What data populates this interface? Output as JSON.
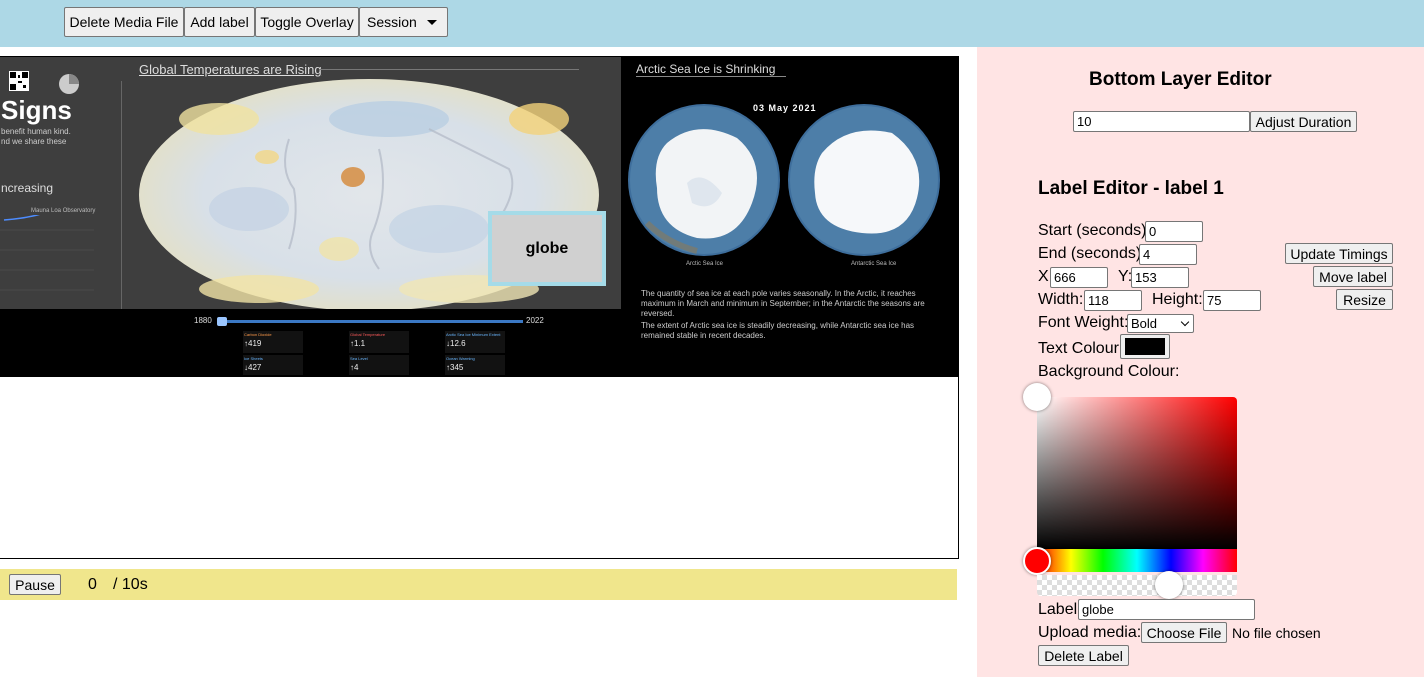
{
  "toolbar": {
    "delete_media": "Delete Media File",
    "add_label": "Add label",
    "toggle_overlay": "Toggle Overlay",
    "session": "Session"
  },
  "media": {
    "left_title": "Global Temperatures are Rising",
    "signs": "Signs",
    "signs_sub1": "benefit human kind.",
    "signs_sub2": "nd we share these",
    "increasing": "ncreasing",
    "mauna_loa": "Mauna Loa Observatory",
    "year_start": "1880",
    "year_end": "2022",
    "year_slider_fraction": 0.0,
    "stats": [
      {
        "title": "Carbon Dioxide",
        "value": "↑419",
        "color": "#ff9a4a"
      },
      {
        "title": "Global Temperature",
        "value": "↑1.1",
        "color": "#ff5a5a"
      },
      {
        "title": "Arctic Sea Ice Minimum Extent",
        "value": "↓12.6",
        "color": "#6ab7ff"
      },
      {
        "title": "Ice Sheets",
        "value": "↓427",
        "color": "#6ab7ff"
      },
      {
        "title": "Sea Level",
        "value": "↑4",
        "color": "#6ab7ff"
      },
      {
        "title": "Ocean Warming",
        "value": "↑345",
        "color": "#6ab7ff"
      }
    ],
    "right_title": "Arctic Sea Ice is Shrinking",
    "date": "03 May 2021",
    "arctic_caption": "Arctic Sea Ice",
    "antarctic_caption": "Antarctic Sea Ice",
    "paragraph1": "The quantity of sea ice at each pole varies seasonally. In the Arctic, it reaches maximum in March and minimum in September; in the Antarctic the seasons are reversed.",
    "paragraph2": "The extent of Arctic sea ice is steadily decreasing, while Antarctic sea ice has remained stable in recent decades."
  },
  "overlay": {
    "text": "globe"
  },
  "player": {
    "pause_label": "Pause",
    "current_time": "0",
    "duration_text": "/ 10s"
  },
  "bottom_editor": {
    "title": "Bottom Layer Editor",
    "duration_value": "10",
    "adjust_label": "Adjust Duration"
  },
  "label_editor": {
    "title": "Label Editor - label 1",
    "start_label": "Start (seconds):",
    "start_value": "0",
    "end_label": "End (seconds):",
    "end_value": "4",
    "update_timings": "Update Timings",
    "x_label": "X:",
    "x_value": "666",
    "y_label": "Y:",
    "y_value": "153",
    "move_label": "Move label",
    "width_label": "Width:",
    "width_value": "118",
    "height_label": "Height:",
    "height_value": "75",
    "resize": "Resize",
    "font_weight_label": "Font Weight:",
    "font_weight_value": "Bold",
    "text_colour_label": "Text Colour:",
    "text_colour": "#000000",
    "bg_colour_label": "Background Colour:",
    "label_label": "Label:",
    "label_value": "globe",
    "upload_label": "Upload media:",
    "choose_file": "Choose File",
    "no_file": "No file chosen",
    "delete_label": "Delete Label"
  },
  "colors": {
    "topbar": "#add8e6",
    "editor_bg": "#ffe4e4",
    "control_bar": "#f0e68c",
    "picker_hue": "#ff0000"
  }
}
